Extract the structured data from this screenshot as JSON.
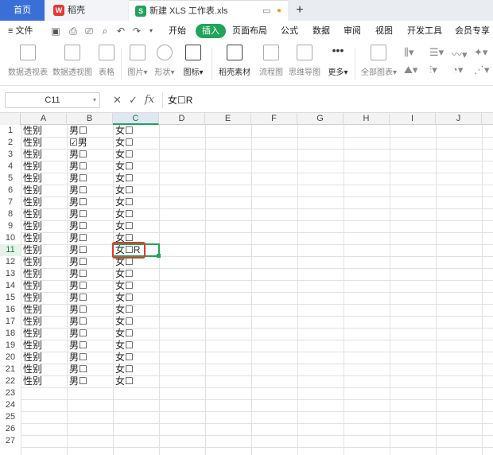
{
  "tabs": {
    "home": "首页",
    "wps": "稻壳",
    "file": "新建 XLS 工作表.xls",
    "add": "+"
  },
  "menu": {
    "file": "文件",
    "items": [
      "开始",
      "插入",
      "页面布局",
      "公式",
      "数据",
      "审阅",
      "视图",
      "开发工具",
      "会员专享"
    ],
    "active": "插入"
  },
  "toolbar": {
    "items": [
      "数据透视表",
      "数据透视图",
      "表格",
      "图片",
      "形状",
      "图标",
      "稻壳素材",
      "流程图",
      "思维导图",
      "更多",
      "全部图表"
    ]
  },
  "formula_bar": {
    "cell_ref": "C11",
    "fx": "fx",
    "value": "女☐R"
  },
  "columns": [
    "A",
    "B",
    "C",
    "D",
    "E",
    "F",
    "G",
    "H",
    "I",
    "J"
  ],
  "active_column": "C",
  "active_row": 11,
  "rows": [
    {
      "n": "1",
      "a": "性别",
      "b": "男☐",
      "c": "女☐"
    },
    {
      "n": "2",
      "a": "性别",
      "b": "☑男",
      "c": "女☐"
    },
    {
      "n": "3",
      "a": "性别",
      "b": "男☐",
      "c": "女☐"
    },
    {
      "n": "4",
      "a": "性别",
      "b": "男☐",
      "c": "女☐"
    },
    {
      "n": "5",
      "a": "性别",
      "b": "男☐",
      "c": "女☐"
    },
    {
      "n": "6",
      "a": "性别",
      "b": "男☐",
      "c": "女☐"
    },
    {
      "n": "7",
      "a": "性别",
      "b": "男☐",
      "c": "女☐"
    },
    {
      "n": "8",
      "a": "性别",
      "b": "男☐",
      "c": "女☐"
    },
    {
      "n": "9",
      "a": "性别",
      "b": "男☐",
      "c": "女☐"
    },
    {
      "n": "10",
      "a": "性别",
      "b": "男☐",
      "c": "女☐"
    },
    {
      "n": "11",
      "a": "性别",
      "b": "男☐",
      "c": "女☐R"
    },
    {
      "n": "12",
      "a": "性别",
      "b": "男☐",
      "c": "女☐"
    },
    {
      "n": "13",
      "a": "性别",
      "b": "男☐",
      "c": "女☐"
    },
    {
      "n": "14",
      "a": "性别",
      "b": "男☐",
      "c": "女☐"
    },
    {
      "n": "15",
      "a": "性别",
      "b": "男☐",
      "c": "女☐"
    },
    {
      "n": "16",
      "a": "性别",
      "b": "男☐",
      "c": "女☐"
    },
    {
      "n": "17",
      "a": "性别",
      "b": "男☐",
      "c": "女☐"
    },
    {
      "n": "18",
      "a": "性别",
      "b": "男☐",
      "c": "女☐"
    },
    {
      "n": "19",
      "a": "性别",
      "b": "男☐",
      "c": "女☐"
    },
    {
      "n": "20",
      "a": "性别",
      "b": "男☐",
      "c": "女☐"
    },
    {
      "n": "21",
      "a": "性别",
      "b": "男☐",
      "c": "女☐"
    },
    {
      "n": "22",
      "a": "性别",
      "b": "男☐",
      "c": "女☐"
    },
    {
      "n": "23",
      "a": "",
      "b": "",
      "c": ""
    },
    {
      "n": "24",
      "a": "",
      "b": "",
      "c": ""
    },
    {
      "n": "25",
      "a": "",
      "b": "",
      "c": ""
    },
    {
      "n": "26",
      "a": "",
      "b": "",
      "c": ""
    },
    {
      "n": "27",
      "a": "",
      "b": "",
      "c": ""
    }
  ],
  "colors": {
    "accent": "#22a35a",
    "home_tab": "#3a6fd8",
    "highlight": "#e5352b"
  }
}
